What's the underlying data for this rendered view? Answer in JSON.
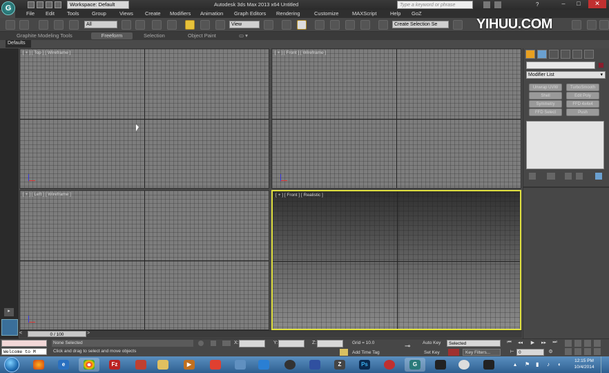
{
  "title_bar": {
    "workspace": "Workspace: Default",
    "title": "Autodesk 3ds Max 2013 x64    Untitled",
    "search_placeholder": "Type a keyword or phrase"
  },
  "menu": [
    "File",
    "Edit",
    "Tools",
    "Group",
    "Views",
    "Create",
    "Modifiers",
    "Animation",
    "Graph Editors",
    "Rendering",
    "Customize",
    "MAXScript",
    "Help",
    "GoZ"
  ],
  "toolbar": {
    "selection_filter": "All",
    "coord_system": "View",
    "named_selection": "Create Selection Se",
    "watermark": "YIHUU.COM"
  },
  "ribbon": {
    "tabs": [
      "Graphite Modeling Tools",
      "Freeform",
      "Selection",
      "Object Paint"
    ],
    "defaults": "Defaults"
  },
  "viewports": {
    "top": "[ + ] [ Top ] [ Wireframe ]",
    "front": "[ + ] [ Front ] [ Wireframe ]",
    "left": "[ + ] [ Left ] [ Wireframe ]",
    "persp": "[ + ] [ Front ] [ Realistic ]"
  },
  "command_panel": {
    "modifier_list": "Modifier List",
    "buttons": [
      "Unwrap UVW",
      "TurboSmooth",
      "Shell",
      "Edit Poly",
      "Symmetry",
      "FFD 4x4x4",
      "FFD Select",
      "Push"
    ],
    "swatch_color": "#8a1e2e"
  },
  "time_slider": {
    "position": "0 / 100"
  },
  "status": {
    "selection": "None Selected",
    "prompt": "Click and drag to select and move objects",
    "x_label": "X:",
    "y_label": "Y:",
    "z_label": "Z:",
    "grid": "Grid = 10.0",
    "add_time_tag": "Add Time Tag",
    "auto_key": "Auto Key",
    "set_key": "Set Key",
    "selected": "Selected",
    "key_filters": "Key Filters...",
    "frame": "0",
    "welcome": "Welcome to M"
  },
  "taskbar": {
    "time": "12:15 PM",
    "date": "10/4/2014"
  }
}
